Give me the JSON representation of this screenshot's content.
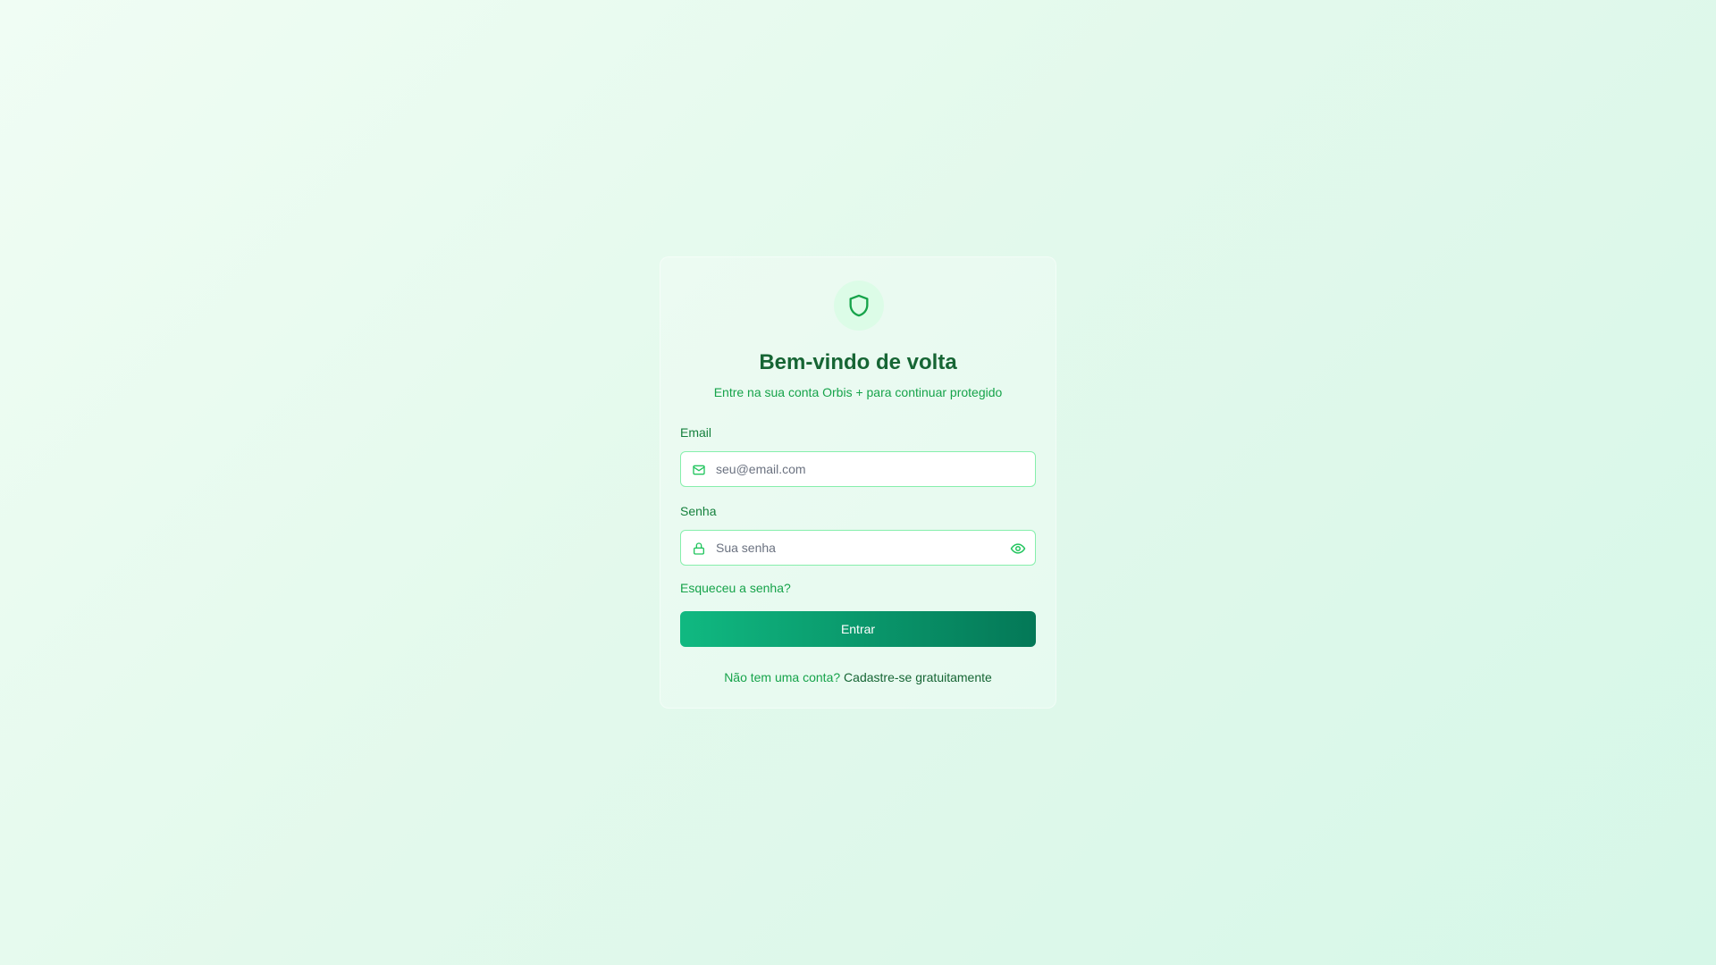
{
  "theme": {
    "background": "#e3f9ec",
    "primary": "#16a34a",
    "primary_dark": "#166534",
    "button_gradient_start": "#10b981",
    "button_gradient_end": "#047857"
  },
  "logo": {
    "icon": "shield-icon"
  },
  "header": {
    "title": "Bem-vindo de volta",
    "subtitle": "Entre na sua conta Orbis + para continuar protegido"
  },
  "form": {
    "email": {
      "label": "Email",
      "icon": "mail-icon",
      "value": "",
      "placeholder": "seu@email.com"
    },
    "password": {
      "label": "Senha",
      "icon": "lock-icon",
      "toggle_icon": "eye-icon",
      "value": "",
      "placeholder": "Sua senha"
    },
    "forgot_link": "Esqueceu a senha?",
    "submit_label": "Entrar"
  },
  "footer": {
    "prompt": "Não tem uma conta?",
    "signup_link": "Cadastre-se gratuitamente"
  }
}
